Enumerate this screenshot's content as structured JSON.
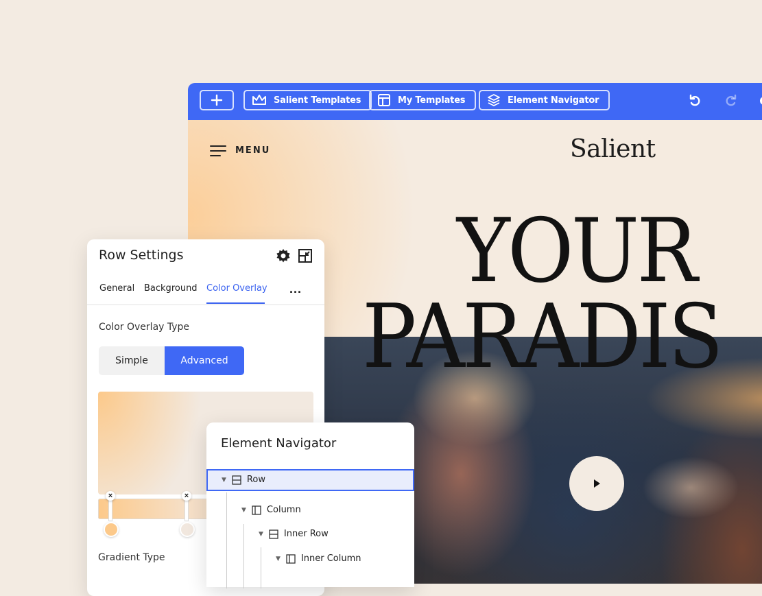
{
  "toolbar": {
    "add_label": "+",
    "salient_templates": "Salient Templates",
    "my_templates": "My Templates",
    "element_navigator": "Element Navigator",
    "accent_color": "#3f68f5"
  },
  "site": {
    "menu_label": "MENU",
    "brand": "Salient",
    "headline_line1": "YOUR",
    "headline_line2": "PARADIS"
  },
  "row_settings": {
    "title": "Row Settings",
    "tabs": [
      {
        "label": "General"
      },
      {
        "label": "Background"
      },
      {
        "label": "Color Overlay",
        "active": true
      }
    ],
    "more_label": "...",
    "overlay_type_label": "Color Overlay Type",
    "segment_simple": "Simple",
    "segment_advanced": "Advanced",
    "selected_segment": "Advanced",
    "gradient_type_label": "Gradient Type",
    "gradient_stops": [
      {
        "color": "#fcc98a",
        "remove_label": "×"
      },
      {
        "color": "#f1e7de",
        "remove_label": "×"
      }
    ]
  },
  "navigator": {
    "title": "Element Navigator",
    "items": [
      {
        "label": "Row",
        "icon": "row-icon",
        "selected": true
      },
      {
        "label": "Column",
        "icon": "column-icon"
      },
      {
        "label": "Inner Row",
        "icon": "row-icon"
      },
      {
        "label": "Inner Column",
        "icon": "column-icon"
      }
    ]
  }
}
